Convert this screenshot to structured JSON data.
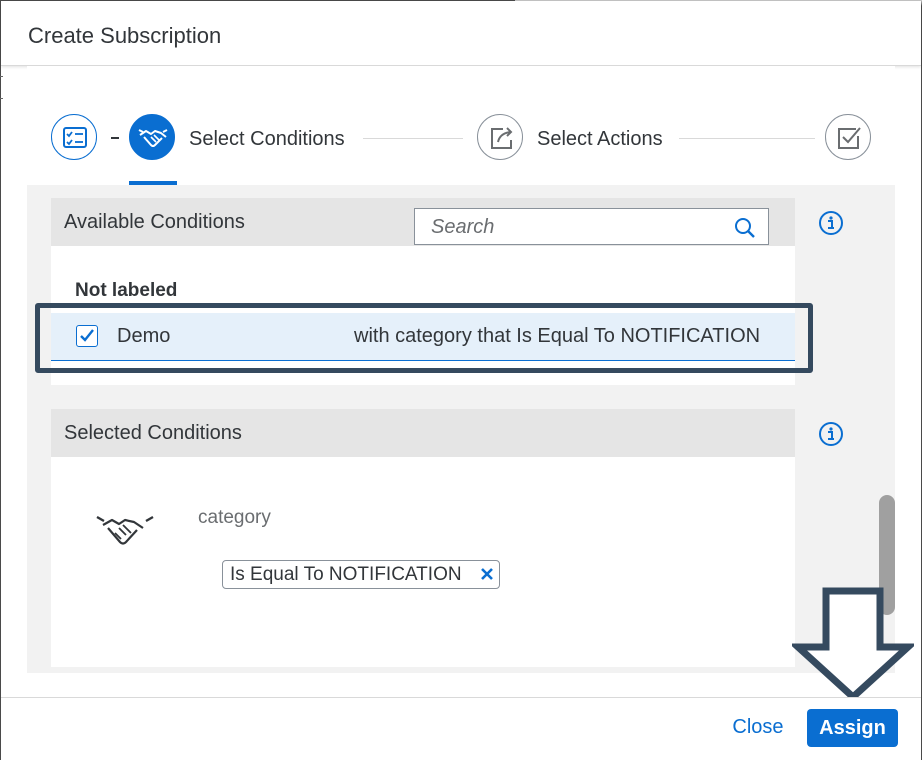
{
  "dialog": {
    "title": "Create Subscription"
  },
  "wizard": {
    "steps": [
      {
        "icon": "checklist-icon",
        "label": "",
        "state": "done"
      },
      {
        "icon": "handshake-icon",
        "label": "Select Conditions",
        "state": "active"
      },
      {
        "icon": "share-icon",
        "label": "Select Actions",
        "state": "upcoming"
      },
      {
        "icon": "checkbox-icon",
        "label": "",
        "state": "upcoming"
      }
    ],
    "separator_text": "-"
  },
  "available_conditions": {
    "title": "Available Conditions",
    "search_placeholder": "Search",
    "search_value": "",
    "group_label": "Not labeled",
    "rows": [
      {
        "name": "Demo",
        "description": "with category that Is Equal To NOTIFICATION",
        "checked": true
      }
    ]
  },
  "selected_conditions": {
    "title": "Selected Conditions",
    "field": "category",
    "token": "Is Equal To NOTIFICATION",
    "icon": "handshake-icon"
  },
  "footer": {
    "close_label": "Close",
    "assign_label": "Assign"
  },
  "colors": {
    "accent": "#0a6ed1",
    "highlight_border": "#354a5f",
    "header_bg": "#e5e5e5",
    "selected_row_bg": "#e5f0fa"
  }
}
